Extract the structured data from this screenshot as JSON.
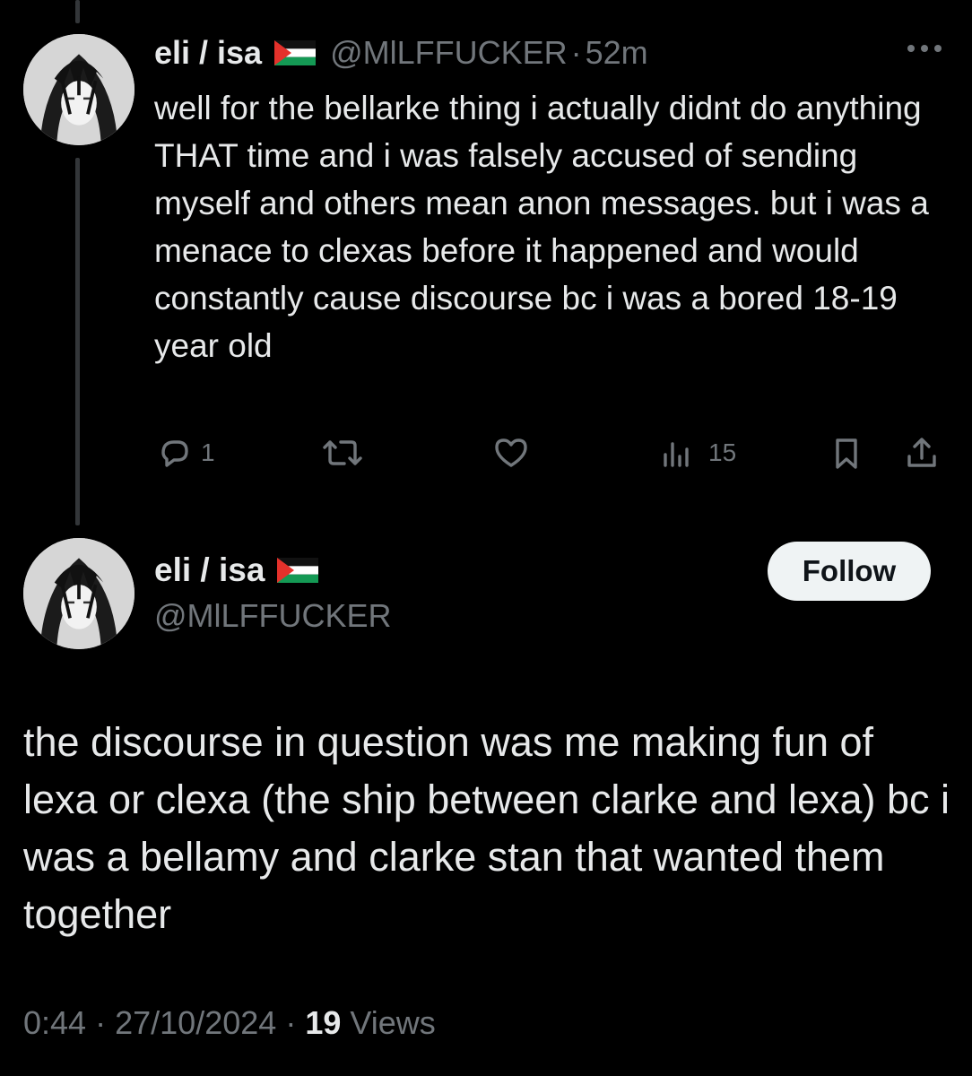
{
  "reply": {
    "name": "eli / isa",
    "flag_icon": "palestine-flag-icon",
    "handle": "@MlLFFUCKER",
    "separator": "·",
    "time": "52m",
    "text": "well for the bellarke thing i actually didnt do anything THAT time and i was falsely accused of sending myself and others mean anon messages. but i was a menace to clexas before it happened and would constantly cause discourse bc i was a bored 18-19 year old",
    "reply_count": "1",
    "retweet_count": "",
    "like_count": "",
    "views_count": "15"
  },
  "main": {
    "name": "eli / isa",
    "flag_icon": "palestine-flag-icon",
    "handle": "@MlLFFUCKER",
    "follow_label": "Follow",
    "text": "the discourse in question was me making fun of lexa or clexa (the ship between clarke and lexa) bc i was a bellamy and clarke stan that wanted them together",
    "time": "0:44",
    "separator": "·",
    "date": "27/10/2024",
    "views_count": "19",
    "views_label": "Views"
  },
  "colors": {
    "background": "#000000",
    "text": "#e7e9ea",
    "muted": "#71767b",
    "follow_bg": "#eff3f4"
  }
}
